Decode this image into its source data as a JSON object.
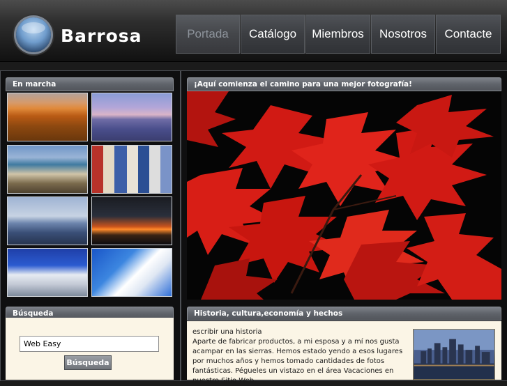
{
  "header": {
    "site_title": "Barrosa",
    "nav": [
      "Portada",
      "Catálogo",
      "Miembros",
      "Nosotros",
      "Contacte"
    ],
    "active_nav": "Portada"
  },
  "left_panel": {
    "title": "En marcha",
    "thumbnails": [
      "sandy-beach-sunset",
      "calm-sea-sunset",
      "rocky-coast",
      "beach-huts",
      "harbor-sailboats",
      "bridge-at-night",
      "white-village",
      "snowy-rocks"
    ]
  },
  "search": {
    "title": "Búsqueda",
    "input_value": "Web Easy",
    "button_label": "Búsqueda"
  },
  "main": {
    "title": "¡Aquí comienza el camino para una mejor fotografía!",
    "image": "red-maple-leaves"
  },
  "article": {
    "title": "Historia, cultura,economía y hechos",
    "subtitle": "escribir una historia",
    "body": "Aparte de fabricar productos, a mi esposa y a mí nos gusta acampar en las sierras. Hemos estado yendo a esos lugares por muchos años y hemos tomado cantidades de fotos fantásticas. Pégueles un vistazo en el área Vacaciones en nuestro Sitio Web.",
    "image": "city-skyline"
  },
  "colors": {
    "header_dark": "#111111",
    "panel_bg": "#0f0f10",
    "content_bg": "#fbf5e6",
    "accent_red": "#d8201a"
  }
}
